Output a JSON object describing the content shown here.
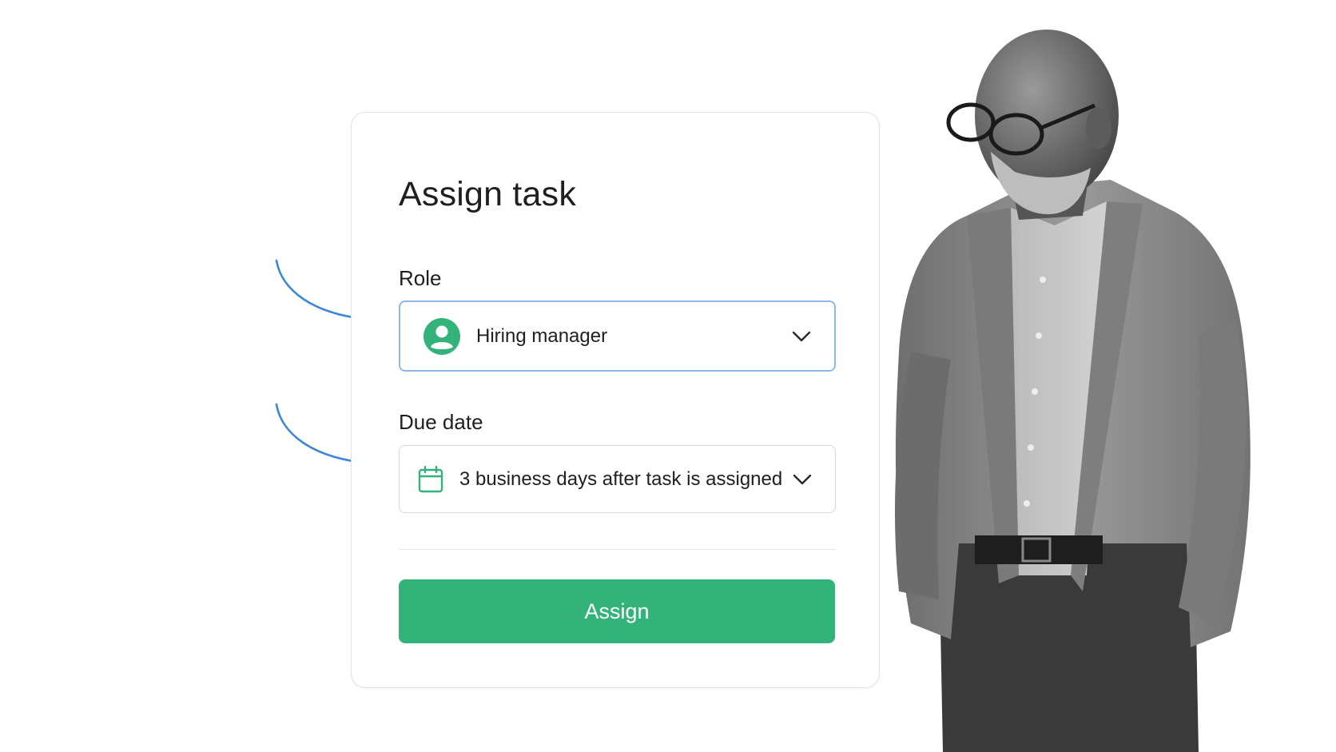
{
  "dialog": {
    "title": "Assign task",
    "role": {
      "label": "Role",
      "value": "Hiring manager",
      "icon": "person-circle-icon"
    },
    "due_date": {
      "label": "Due date",
      "value": "3 business days after task is assigned",
      "icon": "calendar-icon"
    },
    "assign_label": "Assign"
  },
  "colors": {
    "accent_green": "#33b27a",
    "arrow_blue": "#3a86d9",
    "focus_border": "#8fb7e8"
  }
}
